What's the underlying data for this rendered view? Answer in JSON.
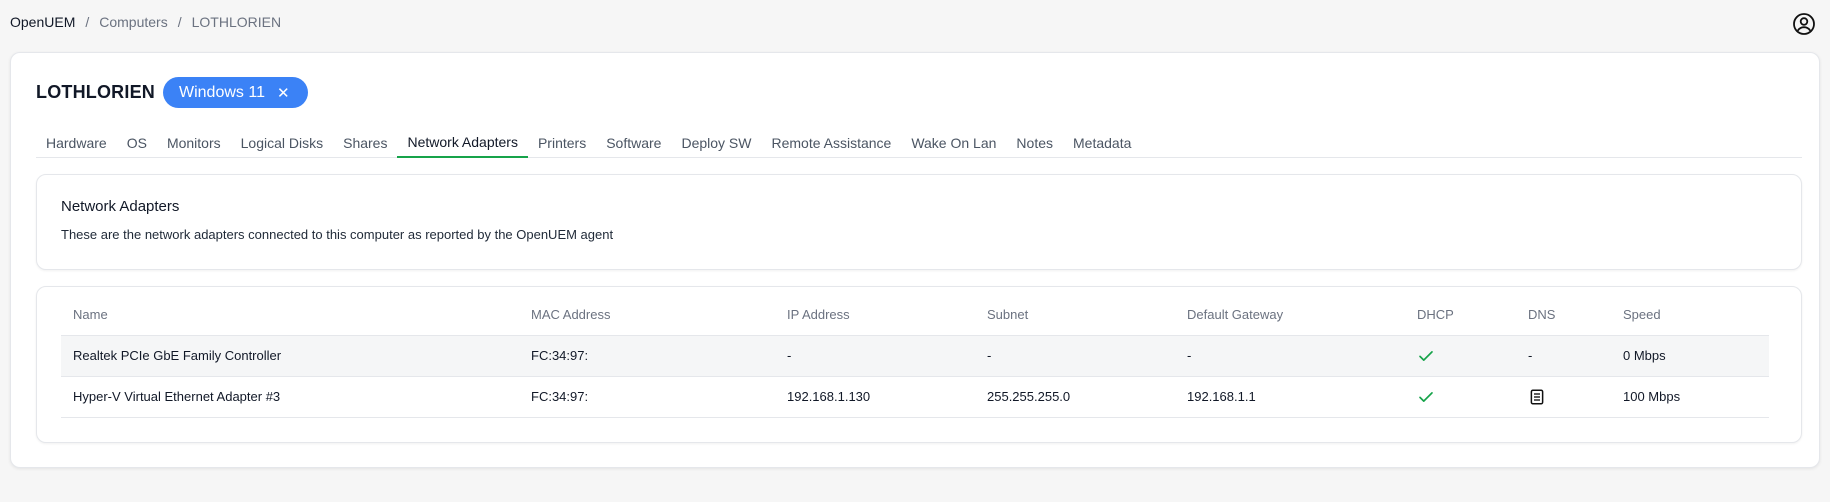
{
  "breadcrumb": {
    "root": "OpenUEM",
    "separator": "/",
    "section": "Computers",
    "current": "LOTHLORIEN"
  },
  "header": {
    "title": "LOTHLORIEN",
    "os_badge": "Windows 11",
    "os_badge_close": "✕"
  },
  "tabs": [
    {
      "label": "Hardware"
    },
    {
      "label": "OS"
    },
    {
      "label": "Monitors"
    },
    {
      "label": "Logical Disks"
    },
    {
      "label": "Shares"
    },
    {
      "label": "Network Adapters",
      "active": true
    },
    {
      "label": "Printers"
    },
    {
      "label": "Software"
    },
    {
      "label": "Deploy SW"
    },
    {
      "label": "Remote Assistance"
    },
    {
      "label": "Wake On Lan"
    },
    {
      "label": "Notes"
    },
    {
      "label": "Metadata"
    }
  ],
  "info": {
    "title": "Network Adapters",
    "description": "These are the network adapters connected to this computer as reported by the OpenUEM agent"
  },
  "table": {
    "columns": [
      "Name",
      "MAC Address",
      "IP Address",
      "Subnet",
      "Default Gateway",
      "DHCP",
      "DNS",
      "Speed"
    ],
    "rows": [
      {
        "name": "Realtek PCIe GbE Family Controller",
        "mac": "FC:34:97:",
        "ip": "-",
        "subnet": "-",
        "gateway": "-",
        "dhcp": "check-icon",
        "dns": "-",
        "speed": "0 Mbps"
      },
      {
        "name": "Hyper-V Virtual Ethernet Adapter #3",
        "mac": "FC:34:97:",
        "ip": "192.168.1.130",
        "subnet": "255.255.255.0",
        "gateway": "192.168.1.1",
        "dhcp": "check-icon",
        "dns": "document-icon",
        "speed": "100 Mbps"
      }
    ]
  },
  "colors": {
    "accent_blue": "#3b82f6",
    "active_tab_underline": "#16a34a",
    "check_green": "#16a34a"
  }
}
